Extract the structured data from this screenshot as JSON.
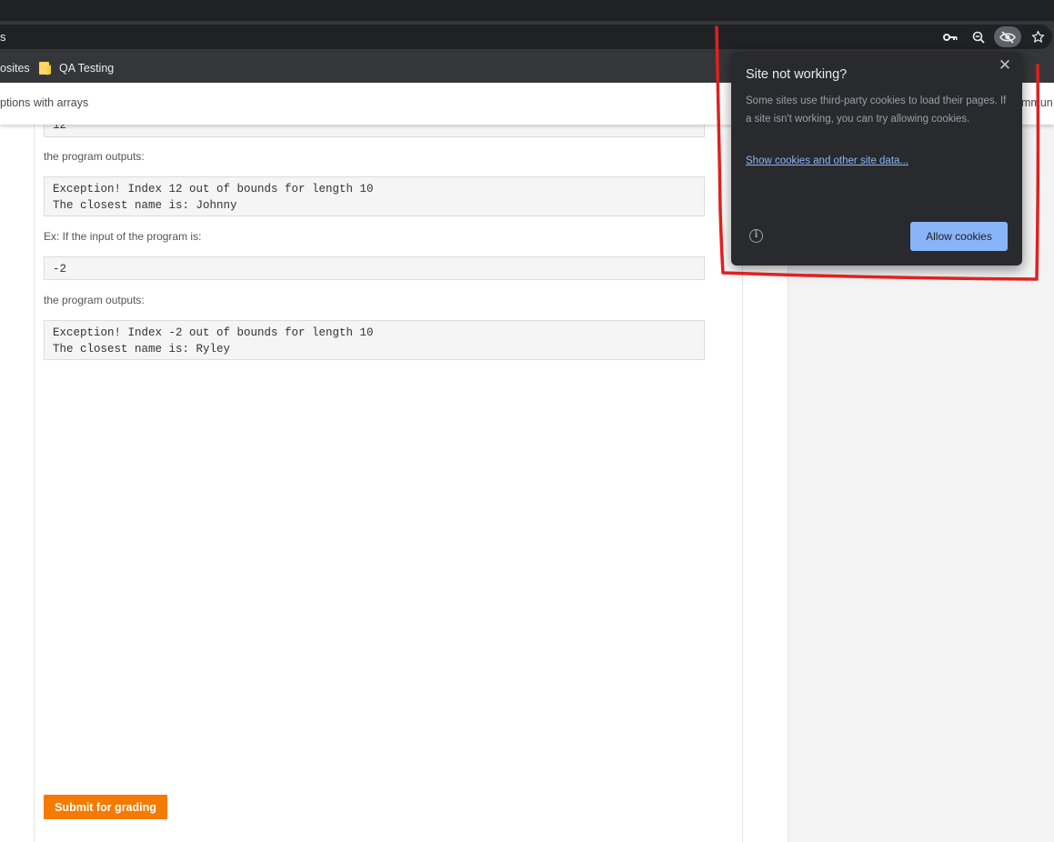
{
  "browser": {
    "url_fragment": "s",
    "bookmarks": [
      {
        "label": "osites"
      },
      {
        "label": "QA Testing"
      }
    ]
  },
  "header": {
    "title": "ptions with arrays",
    "right_fragment": "mmun"
  },
  "content": {
    "top_code_fragment": "12",
    "outputs_label_1": "the program outputs:",
    "output_1": "Exception! Index 12 out of bounds for length 10\nThe closest name is: Johnny",
    "example_label": "Ex: If the input of the program is:",
    "input_2": "-2",
    "outputs_label_2": "the program outputs:",
    "output_2": "Exception! Index -2 out of bounds for length 10\nThe closest name is: Ryley",
    "submit_label": "Submit for grading"
  },
  "popup": {
    "title": "Site not working?",
    "body": "Some sites use third-party cookies to load their pages. If a site isn't working, you can try allowing cookies.",
    "link": "Show cookies and other site data...",
    "allow_label": "Allow cookies",
    "close_glyph": "✕",
    "info_glyph": "i"
  },
  "colors": {
    "accent_button": "#f47b00",
    "popup_button": "#8ab4f8",
    "annotation": "#e0201f"
  }
}
